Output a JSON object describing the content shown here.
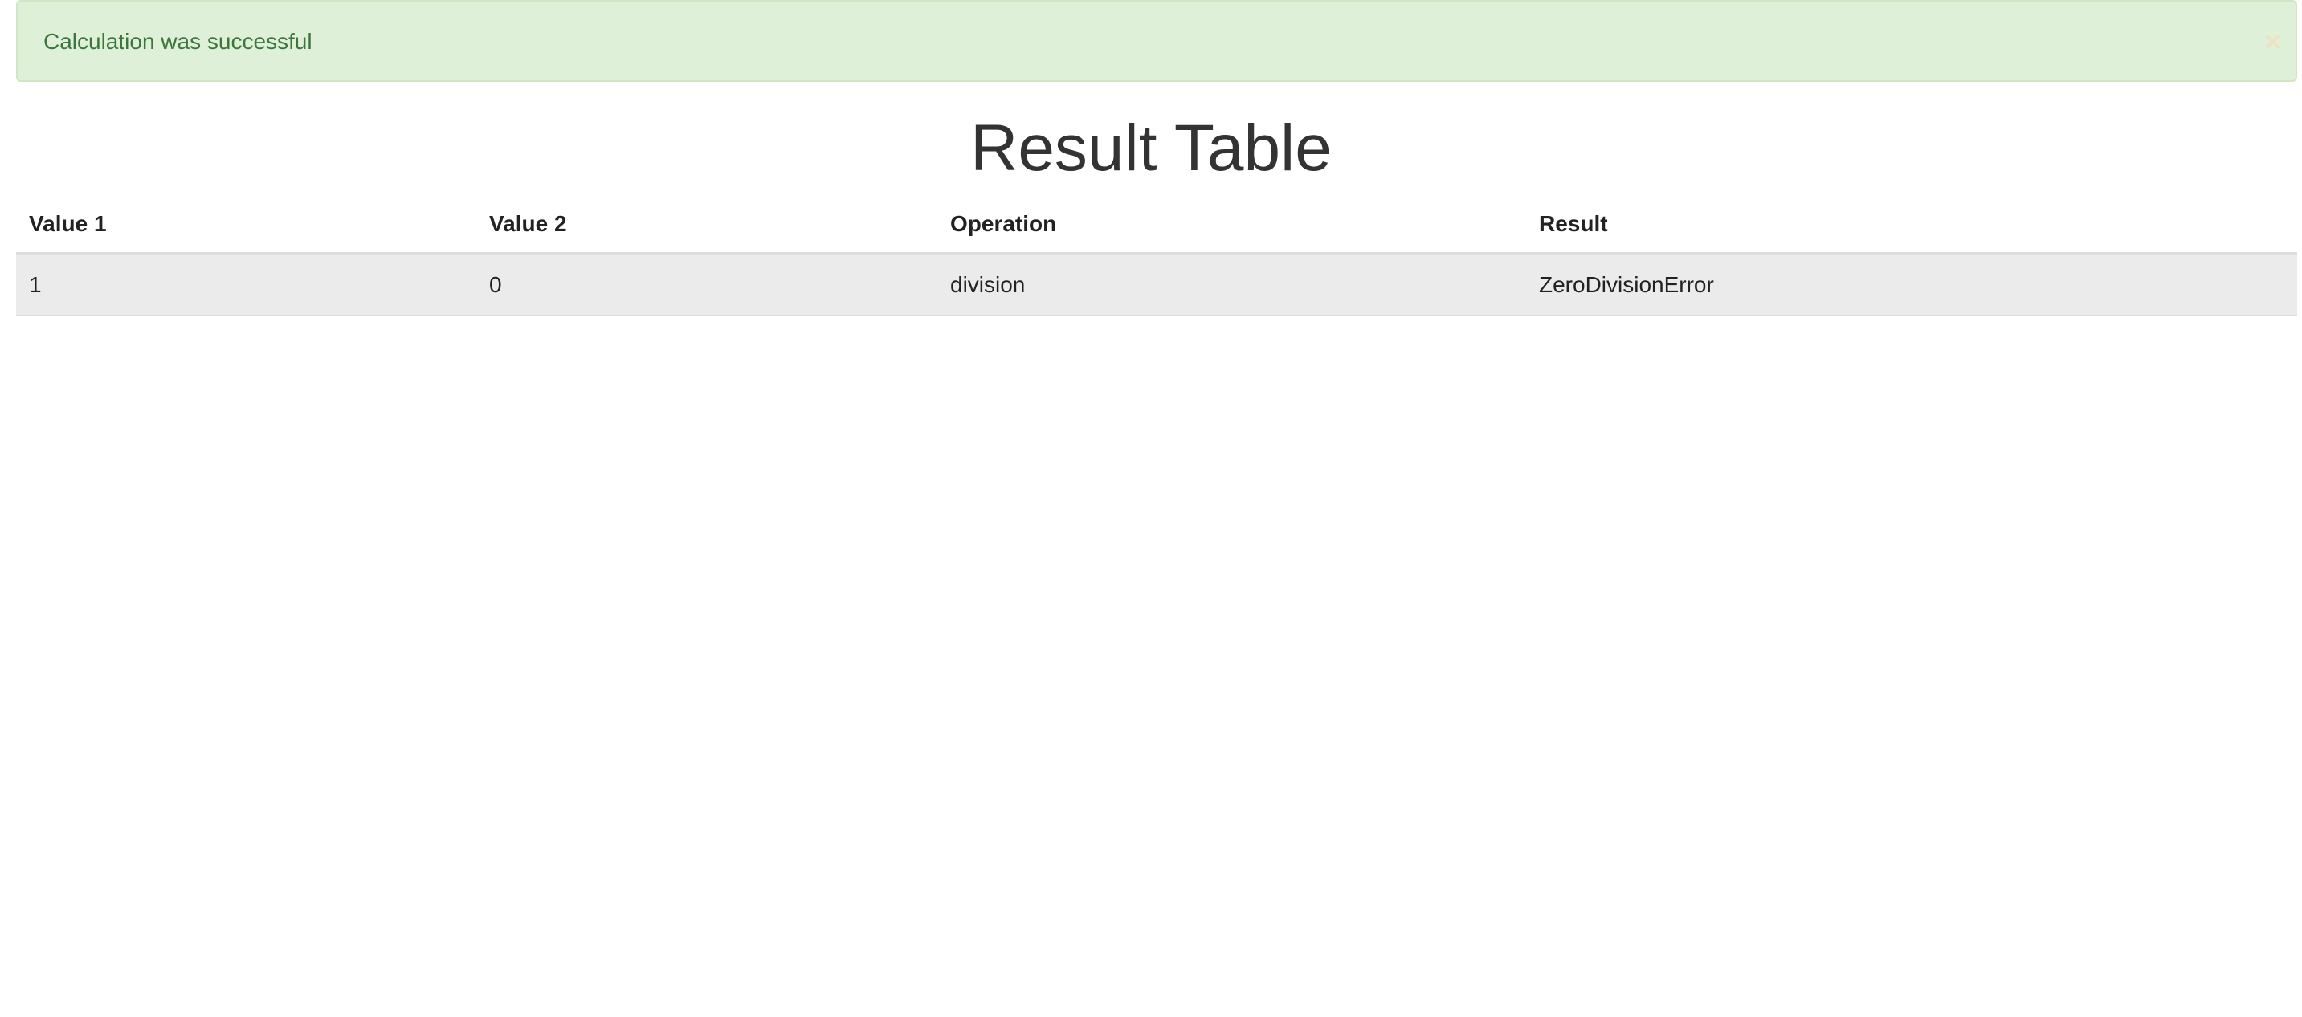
{
  "alert": {
    "message": "Calculation was successful",
    "close_glyph": "×",
    "background_color": "#dff0d8",
    "text_color": "#3c763d"
  },
  "page_title": "Result Table",
  "table": {
    "headers": [
      "Value 1",
      "Value 2",
      "Operation",
      "Result"
    ],
    "rows": [
      [
        "1",
        "0",
        "division",
        "ZeroDivisionError"
      ]
    ]
  }
}
